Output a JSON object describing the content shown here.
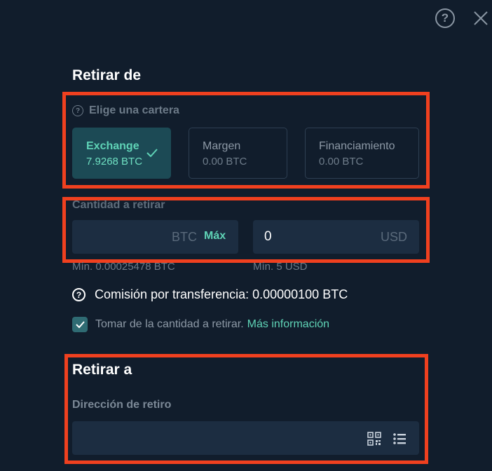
{
  "header": {
    "help_icon": "question-circle-icon",
    "close_icon": "close-icon",
    "help_glyph": "?"
  },
  "withdraw_from": {
    "title": "Retirar de",
    "wallet_label": "Elige una cartera",
    "wallets": [
      {
        "name": "Exchange",
        "balance": "7.9268 BTC",
        "selected": true
      },
      {
        "name": "Margen",
        "balance": "0.00 BTC",
        "selected": false
      },
      {
        "name": "Financiamiento",
        "balance": "0.00 BTC",
        "selected": false
      }
    ]
  },
  "amount": {
    "label": "Cantidad a retirar",
    "btc_unit": "BTC",
    "max_label": "Máx",
    "btc_min": "Mín. 0.00025478 BTC",
    "usd_value": "0",
    "usd_unit": "USD",
    "usd_min": "Mín. 5 USD"
  },
  "fee": {
    "icon_glyph": "?",
    "text": "Comisión por transferencia: 0.00000100 BTC"
  },
  "deduct": {
    "checked": true,
    "text": "Tomar de la cantidad a retirar.",
    "link": "Más información"
  },
  "withdraw_to": {
    "title": "Retirar a",
    "address_label": "Dirección de retiro",
    "address_value": "",
    "qr_icon": "qr-code-icon",
    "list_icon": "list-icon"
  },
  "colors": {
    "accent": "#5fd3b6",
    "highlight": "#f0401f",
    "background": "#111d2c",
    "field": "#1c2d41"
  }
}
